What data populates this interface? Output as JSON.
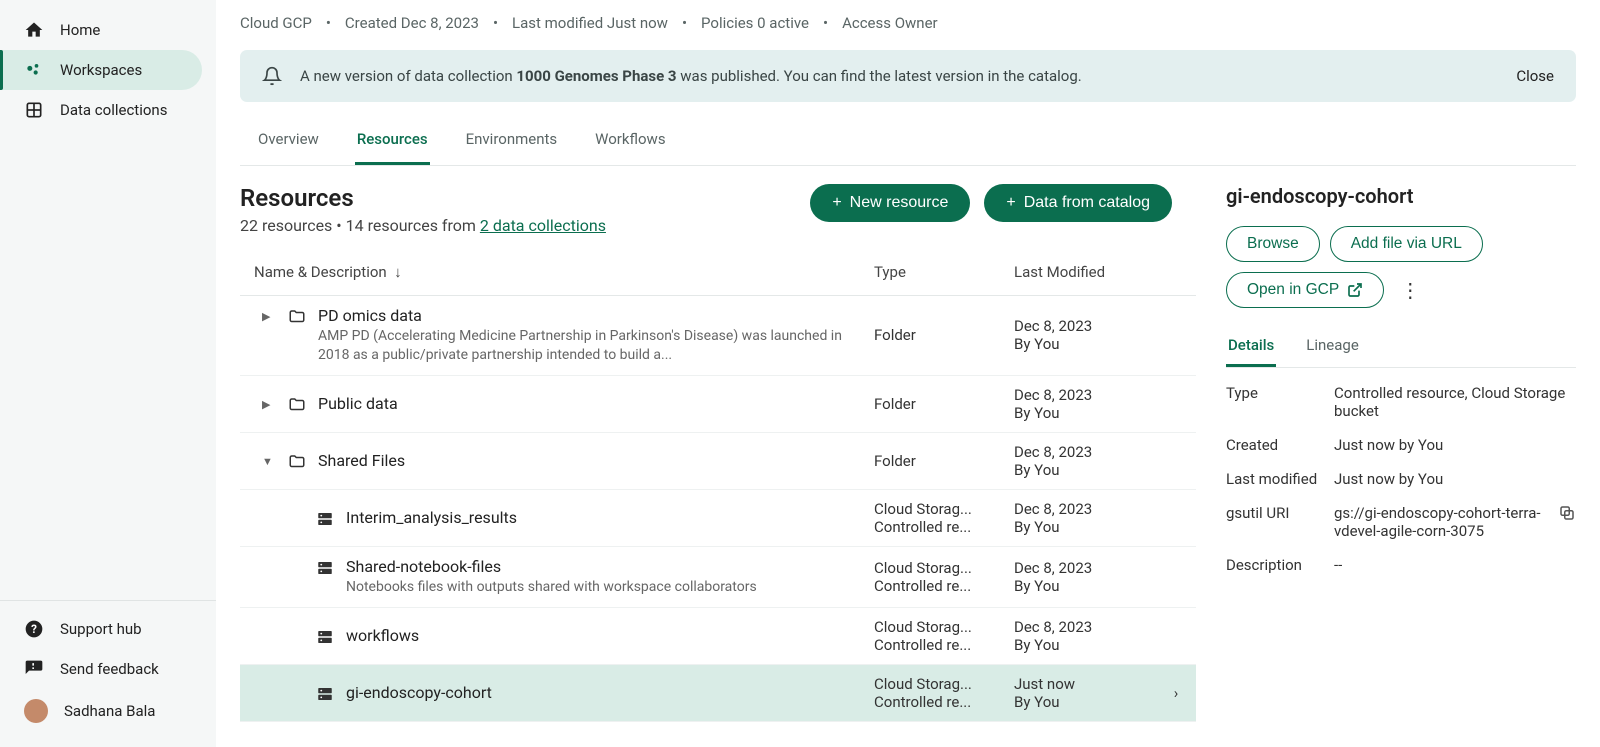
{
  "sidebar": {
    "items": [
      {
        "label": "Home"
      },
      {
        "label": "Workspaces"
      },
      {
        "label": "Data collections"
      }
    ],
    "support": "Support hub",
    "feedback": "Send feedback",
    "user": "Sadhana Bala"
  },
  "meta": {
    "cloud": "Cloud GCP",
    "created": "Created Dec 8, 2023",
    "modified": "Last modified Just now",
    "policies": "Policies 0 active",
    "access": "Access Owner"
  },
  "banner": {
    "prefix": "A new version of data collection ",
    "bold": "1000 Genomes Phase 3",
    "suffix": " was published. You can find the latest version in the catalog.",
    "close": "Close"
  },
  "tabs": [
    {
      "label": "Overview"
    },
    {
      "label": "Resources"
    },
    {
      "label": "Environments"
    },
    {
      "label": "Workflows"
    }
  ],
  "resHeader": {
    "title": "Resources",
    "count_prefix": "22 resources • 14 resources from ",
    "link": "2 data collections",
    "newBtn": "New resource",
    "catalogBtn": "Data from catalog"
  },
  "columns": {
    "name": "Name & Description",
    "type": "Type",
    "modified": "Last Modified"
  },
  "rows": [
    {
      "indent": 0,
      "expand": "▶",
      "icon": "folder",
      "title": "PD omics data",
      "desc": "AMP PD (Accelerating Medicine Partnership in Parkinson's Disease) was launched in 2018 as a public/private partnership intended to build a...",
      "type": "Folder",
      "mod1": "Dec 8, 2023",
      "mod2": "By You"
    },
    {
      "indent": 0,
      "expand": "▶",
      "icon": "folder",
      "title": "Public data",
      "desc": "",
      "type": "Folder",
      "mod1": "Dec 8, 2023",
      "mod2": "By You"
    },
    {
      "indent": 0,
      "expand": "▼",
      "icon": "folder",
      "title": "Shared Files",
      "desc": "",
      "type": "Folder",
      "mod1": "Dec 8, 2023",
      "mod2": "By You"
    },
    {
      "indent": 1,
      "expand": "",
      "icon": "storage",
      "title": "Interim_analysis_results",
      "desc": "",
      "type": "Cloud Storag... Controlled re...",
      "mod1": "Dec 8, 2023",
      "mod2": "By You"
    },
    {
      "indent": 1,
      "expand": "",
      "icon": "storage",
      "title": "Shared-notebook-files",
      "desc": "Notebooks files with outputs shared with workspace collaborators",
      "type": "Cloud Storag... Controlled re...",
      "mod1": "Dec 8, 2023",
      "mod2": "By You"
    },
    {
      "indent": 1,
      "expand": "",
      "icon": "storage",
      "title": "workflows",
      "desc": "",
      "type": "Cloud Storag... Controlled re...",
      "mod1": "Dec 8, 2023",
      "mod2": "By You"
    },
    {
      "indent": 1,
      "expand": "",
      "icon": "storage",
      "title": "gi-endoscopy-cohort",
      "desc": "",
      "type": "Cloud Storag... Controlled re...",
      "mod1": "Just now",
      "mod2": "By You",
      "selected": true
    }
  ],
  "panel": {
    "title": "gi-endoscopy-cohort",
    "browse": "Browse",
    "addUrl": "Add file via URL",
    "openGcp": "Open in GCP",
    "detailsTab": "Details",
    "lineageTab": "Lineage",
    "details": [
      {
        "label": "Type",
        "value": "Controlled resource, Cloud Storage bucket"
      },
      {
        "label": "Created",
        "value": "Just now by You"
      },
      {
        "label": "Last modified",
        "value": "Just now by You"
      },
      {
        "label": "gsutil URI",
        "value": "gs://gi-endoscopy-cohort-terra-vdevel-agile-corn-3075",
        "copy": true
      },
      {
        "label": "Description",
        "value": "--"
      }
    ]
  }
}
